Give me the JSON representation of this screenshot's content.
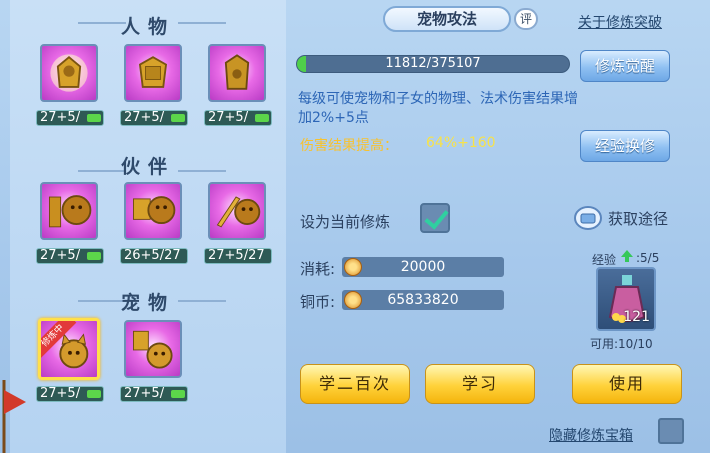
{
  "left": {
    "sections": [
      {
        "title": "人物",
        "items": [
          {
            "level": "27+5/"
          },
          {
            "level": "27+5/"
          },
          {
            "level": "27+5/"
          }
        ]
      },
      {
        "title": "伙伴",
        "items": [
          {
            "level": "27+5/"
          },
          {
            "level": "26+5/27"
          },
          {
            "level": "27+5/27"
          }
        ]
      },
      {
        "title": "宠物",
        "items": [
          {
            "level": "27+5/",
            "badge": "修炼中"
          },
          {
            "level": "27+5/"
          }
        ]
      }
    ]
  },
  "header": {
    "tab_label": "宠物攻法",
    "ping_label": "评",
    "about_link": "关于修炼突破"
  },
  "progress": {
    "text": "11812/375107",
    "fraction": 0.0315,
    "awaken_button": "修炼觉醒"
  },
  "info": {
    "description": "每级可使宠物和子女的物理、法术伤害结果增加2%+5点",
    "damage_label": "伤害结果提高：",
    "damage_value": "64%+160",
    "exchange_button": "经验换修"
  },
  "settings": {
    "set_current_label": "设为当前修炼",
    "set_current_checked": true,
    "obtain_link": "获取途径"
  },
  "cost": {
    "consume_label": "消耗:",
    "consume_value": "20000",
    "copper_label": "铜币:",
    "copper_value": "65833820"
  },
  "item": {
    "exp_label": "经验",
    "exp_value": ":5/5",
    "count": "121",
    "usable_label": "可用:10/10"
  },
  "actions": {
    "learn_200": "学二百次",
    "learn": "学习",
    "use": "使用",
    "hide_chest": "隐藏修炼宝箱"
  },
  "colors": {
    "accent_yellow": "#ffd23a",
    "accent_blue": "#6ea8e6",
    "progress_green": "#4fcf4a",
    "damage_yellow": "#f7c230",
    "desc_blue": "#2d66b6"
  }
}
